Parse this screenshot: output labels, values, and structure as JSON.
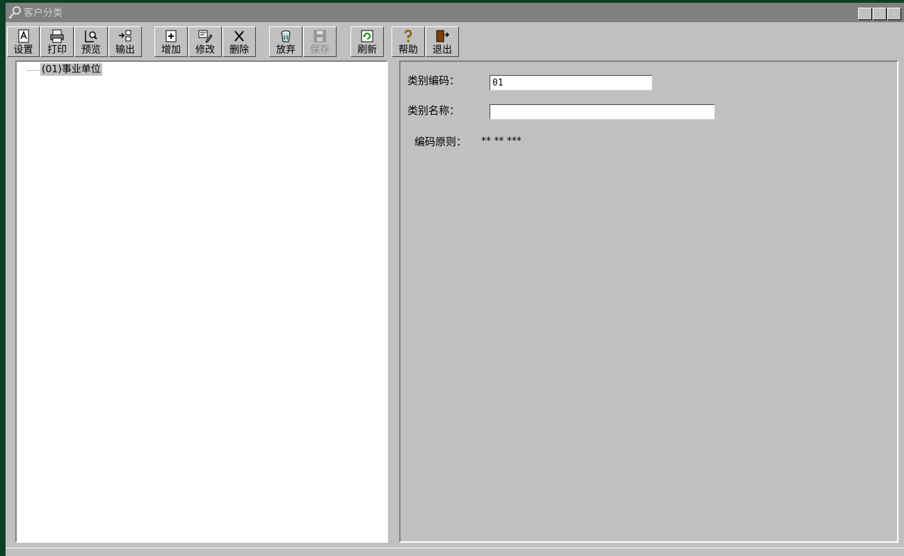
{
  "window": {
    "title": "客户分类",
    "controls": {
      "minimize": "_",
      "restore": "❐",
      "close": "×"
    }
  },
  "toolbar": {
    "buttons": [
      {
        "label": "设置",
        "icon": "page-setup-icon",
        "enabled": true
      },
      {
        "label": "打印",
        "icon": "printer-icon",
        "enabled": true
      },
      {
        "label": "预览",
        "icon": "print-preview-icon",
        "enabled": true
      },
      {
        "label": "输出",
        "icon": "export-icon",
        "enabled": true
      },
      {
        "label": "增加",
        "icon": "add-icon",
        "enabled": true
      },
      {
        "label": "修改",
        "icon": "edit-icon",
        "enabled": true
      },
      {
        "label": "删除",
        "icon": "delete-icon",
        "enabled": true
      },
      {
        "label": "放弃",
        "icon": "discard-icon",
        "enabled": true
      },
      {
        "label": "保存",
        "icon": "save-icon",
        "enabled": false
      },
      {
        "label": "刷新",
        "icon": "refresh-icon",
        "enabled": true
      },
      {
        "label": "帮助",
        "icon": "help-icon",
        "enabled": true
      },
      {
        "label": "退出",
        "icon": "exit-icon",
        "enabled": true
      }
    ]
  },
  "tree": {
    "nodes": [
      {
        "label": "(01)事业单位",
        "selected": true
      }
    ]
  },
  "form": {
    "code_label": "类别编码：",
    "code_value": "01",
    "name_label": "类别名称：",
    "name_value": "",
    "rule_label": "编码原则：",
    "rule_value": "** ** ***"
  },
  "colors": {
    "desktop": "#0d3f26",
    "face": "#c0c0c0",
    "title_inactive": "#808080"
  }
}
